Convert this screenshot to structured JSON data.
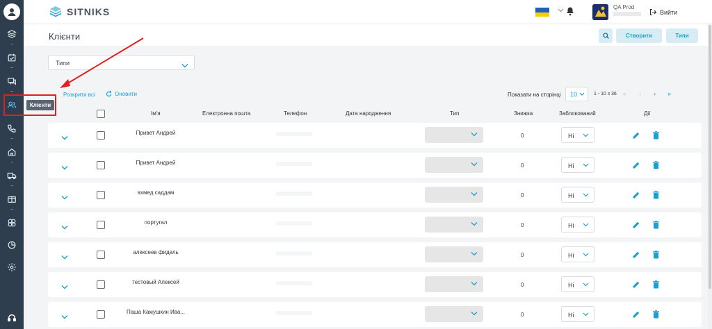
{
  "app": {
    "brand": "SITNIKS"
  },
  "topbar": {
    "user_name": "QA Prod",
    "logout_label": "Вийти"
  },
  "page": {
    "title": "Клієнти"
  },
  "actions": {
    "create_label": "Створити",
    "types_label": "Типи"
  },
  "filter": {
    "label": "Типи"
  },
  "toolbar": {
    "expand_all_label": "Розкрити всі",
    "refresh_label": "Оновити",
    "per_page_label": "Показати на сторінці",
    "per_page_value": "10",
    "range_label": "1 - 10 з 36"
  },
  "tooltip": {
    "text": "Клієнти"
  },
  "table": {
    "columns": {
      "name": "Ім'я",
      "email": "Електронна пошта",
      "phone": "Телефон",
      "birthday": "Дата народження",
      "type": "Тип",
      "discount": "Знижка",
      "blocked": "Заблокований",
      "actions": "Дії"
    },
    "rows": [
      {
        "name": "Привет Андрей",
        "discount": "0",
        "blocked": "Ні"
      },
      {
        "name": "Привет Андрей",
        "discount": "0",
        "blocked": "Ні"
      },
      {
        "name": "ахмед саддам",
        "discount": "0",
        "blocked": "Ні"
      },
      {
        "name": "португал",
        "discount": "0",
        "blocked": "Ні"
      },
      {
        "name": "алексеев фидель",
        "discount": "0",
        "blocked": "Ні"
      },
      {
        "name": "тестовый Алексей",
        "discount": "0",
        "blocked": "Ні"
      },
      {
        "name": "Паша Камушкин Ива...",
        "discount": "0",
        "blocked": "Ні"
      }
    ]
  },
  "colors": {
    "sidebar": "#2e3e4e",
    "accent": "#1a9fd0",
    "highlight": "#e0201c",
    "flag_blue": "#1f5fbf",
    "flag_yellow": "#f5d000"
  },
  "icons": {
    "sidebar": [
      "avatar-icon",
      "layers-icon",
      "calendar-icon",
      "chat-icon",
      "users-icon",
      "phone-icon",
      "home-icon",
      "truck-icon",
      "box-icon",
      "integrations-icon",
      "chart-icon",
      "settings-icon",
      "headset-icon"
    ]
  }
}
